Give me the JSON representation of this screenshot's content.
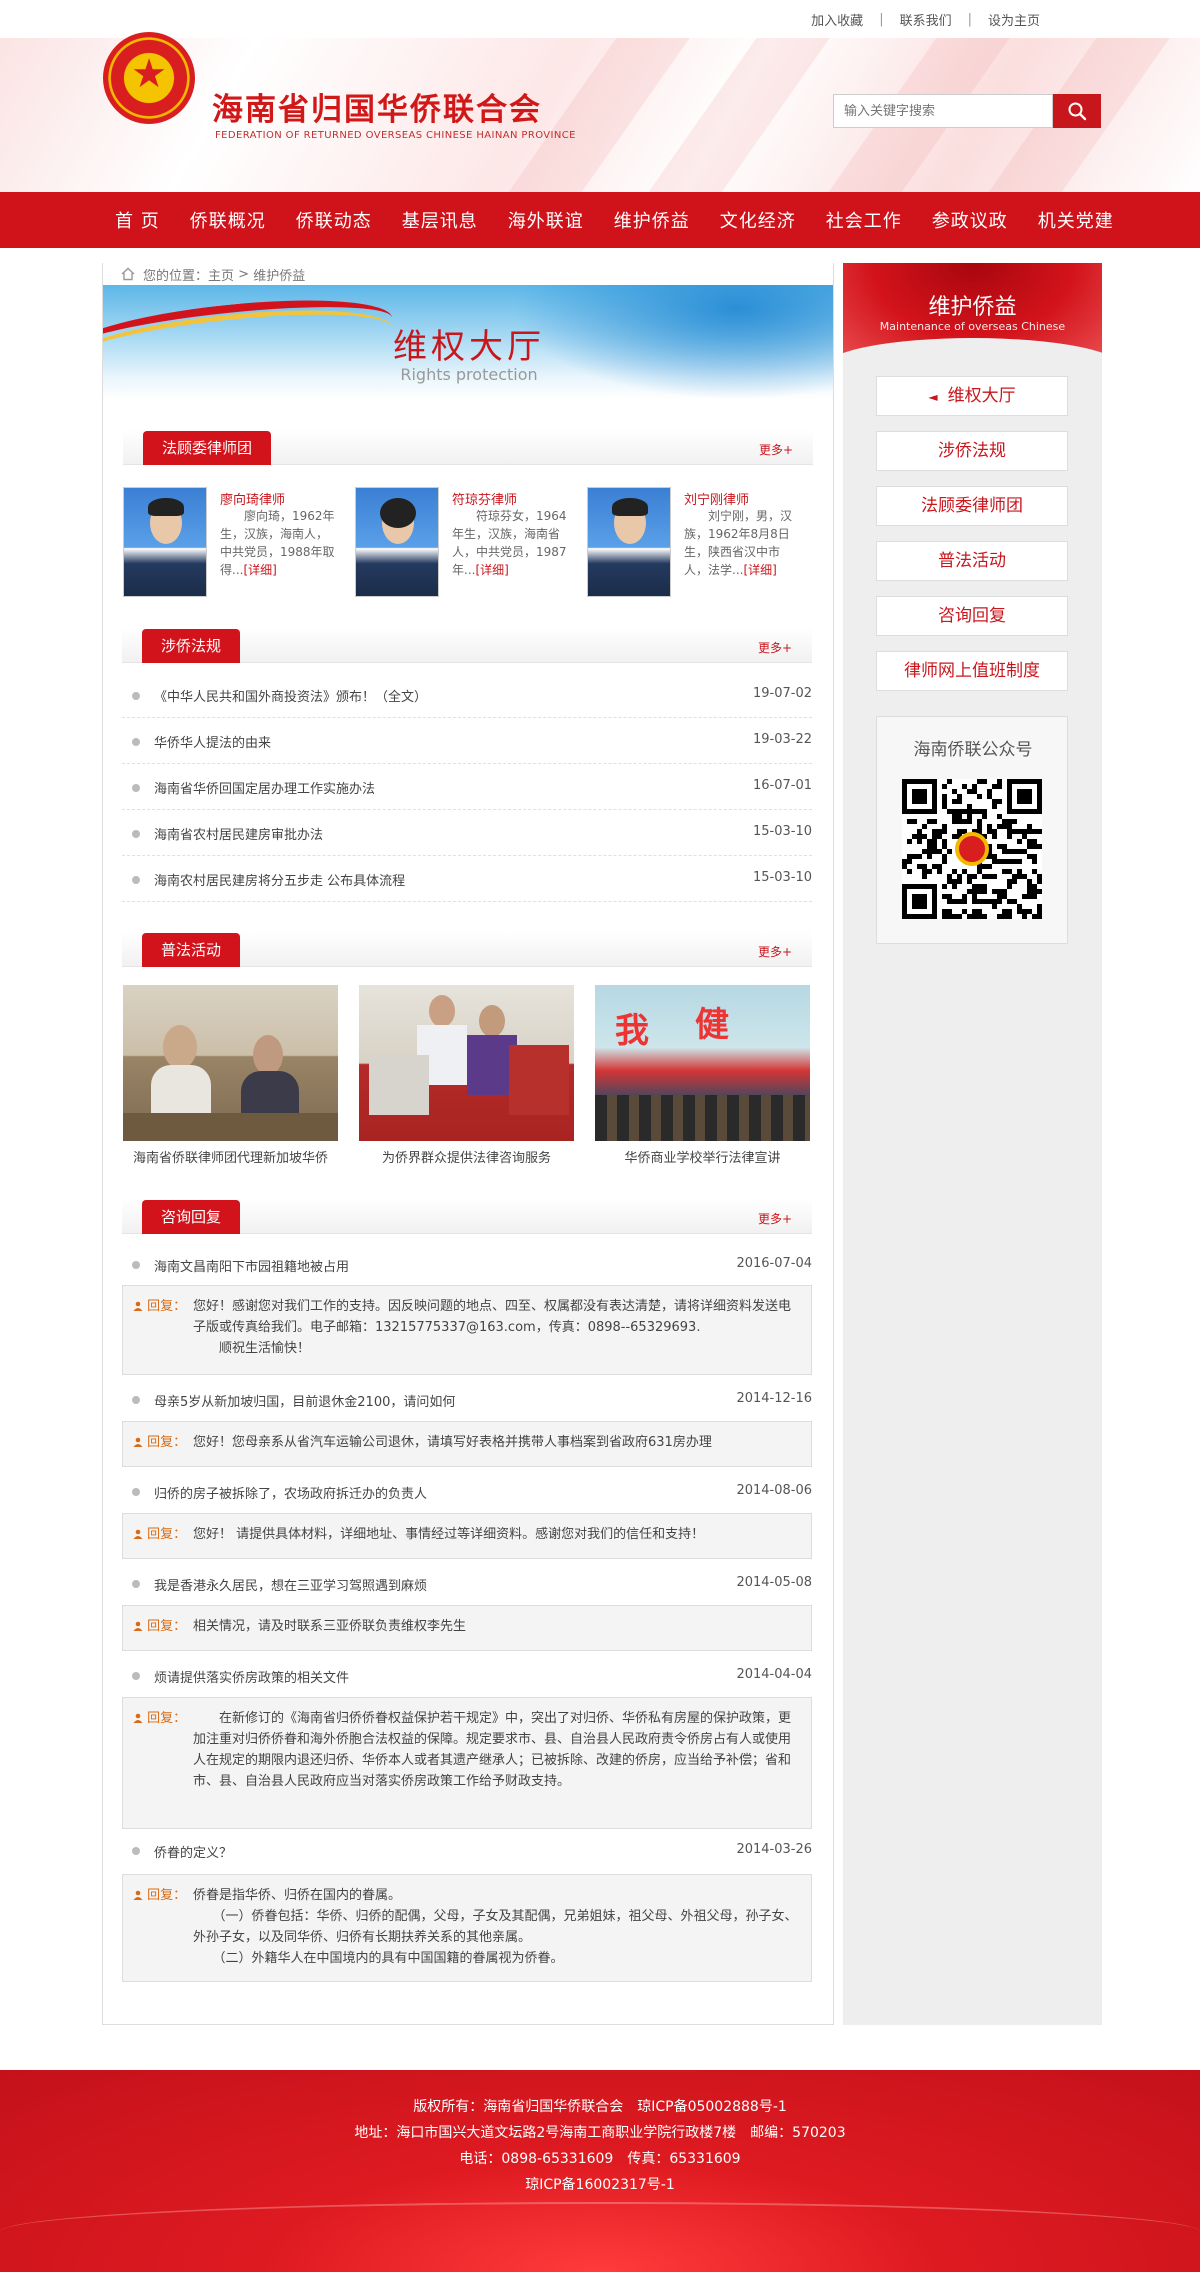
{
  "toplinks": [
    "加入收藏",
    "联系我们",
    "设为主页"
  ],
  "header": {
    "site_name": "海南省归国华侨联合会",
    "site_name_en": "FEDERATION OF RETURNED OVERSEAS CHINESE HAINAN PROVINCE",
    "search_placeholder": "输入关键字搜索"
  },
  "nav": [
    "首 页",
    "侨联概况",
    "侨联动态",
    "基层讯息",
    "海外联谊",
    "维护侨益",
    "文化经济",
    "社会工作",
    "参政议政",
    "机关党建"
  ],
  "breadcrumb": {
    "label": "您的位置：",
    "home": "主页",
    "sep": " > ",
    "current": "维护侨益"
  },
  "banner": {
    "title": "维权大厅",
    "subtitle": "Rights protection"
  },
  "sections": {
    "lawyers": {
      "title": "法顾委律师团",
      "more": "更多+"
    },
    "laws": {
      "title": "涉侨法规",
      "more": "更多+"
    },
    "activities": {
      "title": "普法活动",
      "more": "更多+"
    },
    "consult": {
      "title": "咨询回复",
      "more": "更多+"
    }
  },
  "lawyers": [
    {
      "name": "廖向琦律师",
      "desc": "廖向琦，1962年生，汉族，海南人，中共党员，1988年取得...",
      "detail": "[详细]"
    },
    {
      "name": "符琼芬律师",
      "desc": "符琼芬女，1964年生，汉族，海南省人，中共党员，1987年...",
      "detail": "[详细]"
    },
    {
      "name": "刘宁刚律师",
      "desc": "刘宁刚，男，汉族，1962年8月8日生，陕西省汉中市人，法学...",
      "detail": "[详细]"
    }
  ],
  "laws": [
    {
      "title": "《中华人民共和国外商投资法》颁布！（全文）",
      "date": "19-07-02"
    },
    {
      "title": "华侨华人提法的由来",
      "date": "19-03-22"
    },
    {
      "title": "海南省华侨回国定居办理工作实施办法",
      "date": "16-07-01"
    },
    {
      "title": "海南省农村居民建房审批办法",
      "date": "15-03-10"
    },
    {
      "title": "海南农村居民建房将分五步走 公布具体流程",
      "date": "15-03-10"
    }
  ],
  "activities": [
    {
      "caption": "海南省侨联律师团代理新加坡华侨"
    },
    {
      "caption": "为侨界群众提供法律咨询服务"
    },
    {
      "caption": "华侨商业学校举行法律宣讲"
    }
  ],
  "reply_label": "回复：",
  "consult": [
    {
      "q": "海南文昌南阳下市园祖籍地被占用",
      "date": "2016-07-04",
      "a": [
        "您好！感谢您对我们工作的支持。因反映问题的地点、四至、权属都没有表达清楚，请将详细资料发送电子版或传真给我们。电子邮箱：13215775337@163.com，传真：0898--65329693.",
        "　　顺祝生活愉快！"
      ]
    },
    {
      "q": "母亲5岁从新加坡归国，目前退休金2100，请问如何",
      "date": "2014-12-16",
      "a": [
        "您好！您母亲系从省汽车运输公司退休，请填写好表格并携带人事档案到省政府631房办理"
      ]
    },
    {
      "q": "归侨的房子被拆除了，农场政府拆迁办的负责人",
      "date": "2014-08-06",
      "a": [
        "您好！ 请提供具体材料，详细地址、事情经过等详细资料。感谢您对我们的信任和支持！"
      ]
    },
    {
      "q": "我是香港永久居民，想在三亚学习驾照遇到麻烦",
      "date": "2014-05-08",
      "a": [
        "相关情况，请及时联系三亚侨联负责维权李先生"
      ]
    },
    {
      "q": "烦请提供落实侨房政策的相关文件",
      "date": "2014-04-04",
      "a": [
        "　　在新修订的《海南省归侨侨眷权益保护若干规定》中，突出了对归侨、华侨私有房屋的保护政策，更加注重对归侨侨眷和海外侨胞合法权益的保障。规定要求市、县、自治县人民政府责令侨房占有人或使用人在规定的期限内退还归侨、华侨本人或者其遗产继承人；已被拆除、改建的侨房，应当给予补偿；省和市、县、自治县人民政府应当对落实侨房政策工作给予财政支持。"
      ]
    },
    {
      "q": "侨眷的定义？",
      "date": "2014-03-26",
      "a": [
        "侨眷是指华侨、归侨在国内的眷属。",
        "　　（一）侨眷包括：华侨、归侨的配偶，父母，子女及其配偶，兄弟姐妹，祖父母、外祖父母，孙子女、外孙子女，以及同华侨、归侨有长期扶养关系的其他亲属。",
        "　　（二）外籍华人在中国境内的具有中国国籍的眷属视为侨眷。"
      ]
    }
  ],
  "side": {
    "title": "维护侨益",
    "subtitle": "Maintenance of overseas Chinese",
    "items": [
      "维权大厅",
      "涉侨法规",
      "法顾委律师团",
      "普法活动",
      "咨询回复",
      "律师网上值班制度"
    ],
    "active_marker": "◄",
    "qr_title": "海南侨联公众号"
  },
  "footer": [
    "版权所有：海南省归国华侨联合会　琼ICP备05002888号-1",
    "地址：海口市国兴大道文坛路2号海南工商职业学院行政楼7楼　邮编：570203",
    "电话：0898-65331609　传真：65331609",
    "琼ICP备16002317号-1"
  ],
  "colors": {
    "brand_red": "#d0121b",
    "link_red": "#c8161d",
    "reply_orange": "#d86a15"
  }
}
